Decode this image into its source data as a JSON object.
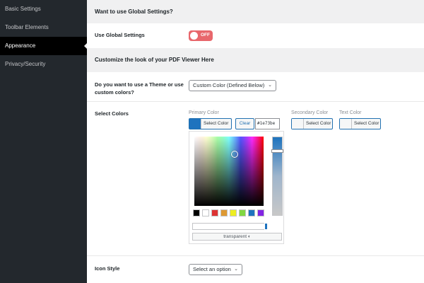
{
  "sidebar": {
    "items": [
      {
        "label": "Basic Settings"
      },
      {
        "label": "Toolbar Elements"
      },
      {
        "label": "Appearance"
      },
      {
        "label": "Privacy/Security"
      }
    ]
  },
  "global": {
    "heading": "Want to use Global Settings?",
    "label": "Use Global Settings",
    "toggle_text": "OFF"
  },
  "customize": {
    "heading": "Customize the look of your PDF Viewer Here",
    "theme_question": "Do you want to use a Theme or use custom colors?",
    "theme_value": "Custom Color (Defined Below)"
  },
  "colors": {
    "label": "Select Colors",
    "primary_label": "Primary Color",
    "primary_color": "#1e73be",
    "select_color_label": "Select Color",
    "clear_label": "Clear",
    "hex_value": "#1e73be",
    "secondary_label": "Secondary Color",
    "text_label": "Text Color",
    "transparent_label": "transparent ◐",
    "palette": [
      "#000000",
      "#ffffff",
      "#dd3333",
      "#dd9933",
      "#eeee22",
      "#81d742",
      "#1e73be",
      "#8224e3"
    ]
  },
  "icon_style": {
    "label": "Icon Style",
    "value": "Select an option"
  }
}
